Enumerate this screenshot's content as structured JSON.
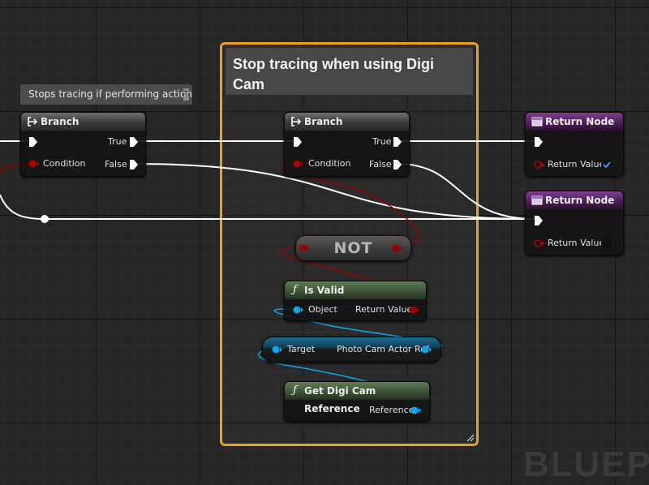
{
  "comment": {
    "title": "Stop tracing when using Digi Cam"
  },
  "tooltip": {
    "text": "Stops tracing if performing action"
  },
  "nodes": {
    "branch_left": {
      "title": "Branch",
      "true_label": "True",
      "condition_label": "Condition",
      "false_label": "False"
    },
    "branch_right": {
      "title": "Branch",
      "true_label": "True",
      "condition_label": "Condition",
      "false_label": "False"
    },
    "return_top": {
      "title": "Return Node",
      "return_value_label": "Return Value",
      "checked": true
    },
    "return_bottom": {
      "title": "Return Node",
      "return_value_label": "Return Value",
      "checked": false
    },
    "not": {
      "label": "NOT"
    },
    "is_valid": {
      "title": "Is Valid",
      "object_label": "Object",
      "return_value_label": "Return Value"
    },
    "photo_cam_ref": {
      "target_label": "Target",
      "output_label": "Photo Cam Actor Ref"
    },
    "get_digi_cam": {
      "title": "Get Digi Cam Reference",
      "reference_label": "Reference"
    }
  },
  "watermark": {
    "text": "BLUEPR"
  },
  "colors": {
    "exec_wire": "#ffffff",
    "bool_pin": "#9b0000",
    "object_pin": "#0aa6ee",
    "comment_border": "#e8a31a",
    "function_header": "#4a6a42",
    "return_header": "#5c2668"
  },
  "icons": {
    "branch": "branch-icon",
    "return": "return-node-icon",
    "function": "function-icon",
    "exec": "exec-pin-icon"
  }
}
